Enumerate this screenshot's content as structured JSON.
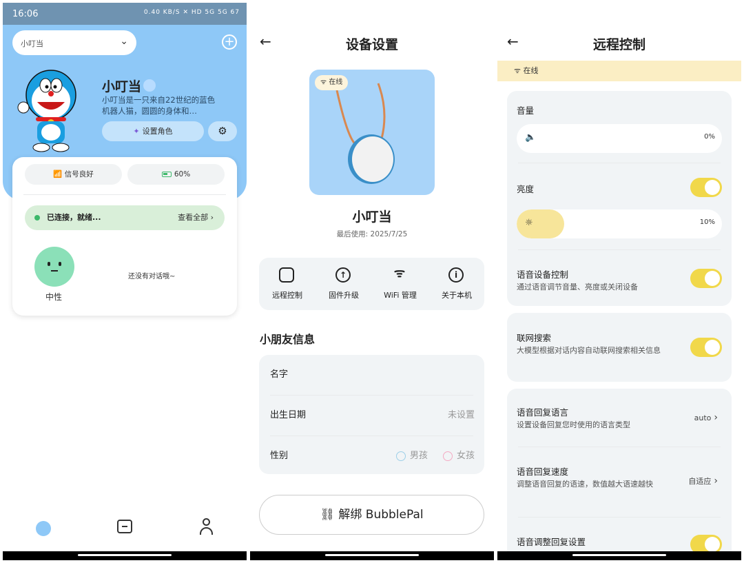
{
  "home": {
    "status_time": "16:06",
    "status_icons": "0.40 KB/S ✕ HD 5G 5G 67",
    "device_select": "小叮当",
    "char_name": "小叮当",
    "char_desc": "小叮当是一只来自22世纪的蓝色机器人猫，圆圆的身体和…",
    "set_role_label": "设置角色",
    "signal_label": "信号良好",
    "battery_label": "60%",
    "battery_level_pct": 60,
    "connection_status": "已连接，就绪...",
    "view_all": "查看全部 ›",
    "gender": "中性",
    "no_chat": "还没有对话哦~"
  },
  "device_settings": {
    "title": "设备设置",
    "online_chip": "在线",
    "device_name": "小叮当",
    "last_used": "最后使用: 2025/7/25",
    "actions": [
      {
        "label": "远程控制",
        "icon": "remote-icon"
      },
      {
        "label": "固件升级",
        "icon": "upgrade-icon"
      },
      {
        "label": "WiFi 管理",
        "icon": "wifi-icon"
      },
      {
        "label": "关于本机",
        "icon": "info-icon"
      }
    ],
    "child_info_title": "小朋友信息",
    "rows": {
      "name_label": "名字",
      "birth_label": "出生日期",
      "birth_value": "未设置",
      "gender_label": "性别",
      "male": "男孩",
      "female": "女孩"
    },
    "unbind_label": "解绑 BubblePal"
  },
  "remote_control": {
    "title": "远程控制",
    "online": "在线",
    "volume_label": "音量",
    "volume_pct": "0%",
    "brightness_label": "亮度",
    "brightness_pct": "10%",
    "voice_control_title": "语音设备控制",
    "voice_control_desc": "通过语音调节音量、亮度或关闭设备",
    "web_search_title": "联网搜索",
    "web_search_desc": "大模型根据对话内容自动联网搜索相关信息",
    "reply_lang_title": "语音回复语言",
    "reply_lang_desc": "设置设备回复您时使用的语言类型",
    "reply_lang_value": "auto",
    "reply_speed_title": "语音回复速度",
    "reply_speed_desc": "调整语音回复的语速，数值越大语速越快",
    "reply_speed_value": "自适应",
    "adjust_title": "语音调整回复设置"
  }
}
